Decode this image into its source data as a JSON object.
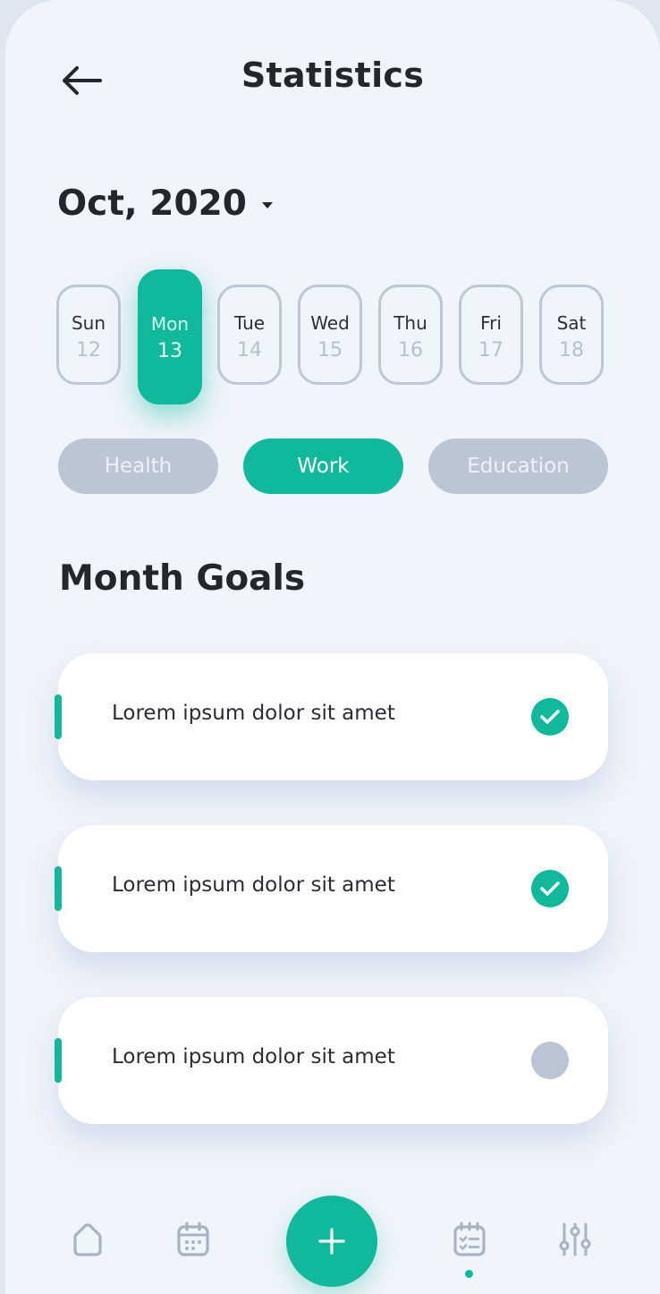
{
  "header": {
    "title": "Statistics",
    "back_icon": "arrow-left-icon"
  },
  "month": {
    "label": "Oct, 2020",
    "caret_icon": "caret-down-icon"
  },
  "days": [
    {
      "name": "Sun",
      "num": "12",
      "selected": false
    },
    {
      "name": "Mon",
      "num": "13",
      "selected": true
    },
    {
      "name": "Tue",
      "num": "14",
      "selected": false
    },
    {
      "name": "Wed",
      "num": "15",
      "selected": false
    },
    {
      "name": "Thu",
      "num": "16",
      "selected": false
    },
    {
      "name": "Fri",
      "num": "17",
      "selected": false
    },
    {
      "name": "Sat",
      "num": "18",
      "selected": false
    }
  ],
  "categories": [
    {
      "label": "Health",
      "selected": false
    },
    {
      "label": "Work",
      "selected": true
    },
    {
      "label": "Education",
      "selected": false
    }
  ],
  "section": {
    "title": "Month Goals"
  },
  "goals": [
    {
      "text": "Lorem ipsum dolor sit amet",
      "done": true
    },
    {
      "text": "Lorem ipsum dolor sit amet",
      "done": true
    },
    {
      "text": "Lorem ipsum dolor sit amet",
      "done": false
    }
  ],
  "nav": {
    "items": [
      "home-icon",
      "calendar-icon",
      "add-icon",
      "tasks-icon",
      "sliders-icon"
    ],
    "active": "tasks-icon"
  },
  "colors": {
    "accent": "#10b99c",
    "inactive": "#bcc5d4",
    "background": "#f0f4fb",
    "text": "#23262f"
  }
}
